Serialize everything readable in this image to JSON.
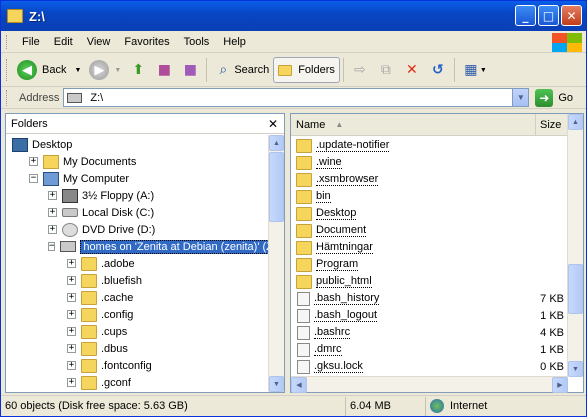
{
  "window": {
    "title": "Z:\\"
  },
  "menu": [
    {
      "label": "File",
      "accel": "F"
    },
    {
      "label": "Edit",
      "accel": "E"
    },
    {
      "label": "View",
      "accel": "V"
    },
    {
      "label": "Favorites",
      "accel": "a"
    },
    {
      "label": "Tools",
      "accel": "T"
    },
    {
      "label": "Help",
      "accel": "H"
    }
  ],
  "toolbar": {
    "back": "Back",
    "search": "Search",
    "folders": "Folders"
  },
  "address": {
    "label": "Address",
    "value": "Z:\\",
    "go": "Go"
  },
  "folders_pane": {
    "title": "Folders",
    "tree": [
      {
        "label": "Desktop",
        "icon": "desk",
        "expander": "",
        "indent": 0
      },
      {
        "label": "My Documents",
        "icon": "mydocs",
        "expander": "+",
        "indent": 1
      },
      {
        "label": "My Computer",
        "icon": "mycomp",
        "expander": "−",
        "indent": 1
      },
      {
        "label": "3½ Floppy (A:)",
        "icon": "floppy",
        "expander": "+",
        "indent": 2
      },
      {
        "label": "Local Disk (C:)",
        "icon": "drive",
        "expander": "+",
        "indent": 2
      },
      {
        "label": "DVD Drive (D:)",
        "icon": "cd",
        "expander": "+",
        "indent": 2
      },
      {
        "label": "homes on 'Zenita at Debian (zenita)' (Z:)",
        "icon": "net",
        "expander": "−",
        "indent": 2,
        "selected": true
      },
      {
        "label": ".adobe",
        "icon": "folder",
        "expander": "+",
        "indent": 3
      },
      {
        "label": ".bluefish",
        "icon": "folder",
        "expander": "+",
        "indent": 3
      },
      {
        "label": ".cache",
        "icon": "folder",
        "expander": "+",
        "indent": 3
      },
      {
        "label": ".config",
        "icon": "folder",
        "expander": "+",
        "indent": 3
      },
      {
        "label": ".cups",
        "icon": "folder",
        "expander": "+",
        "indent": 3
      },
      {
        "label": ".dbus",
        "icon": "folder",
        "expander": "+",
        "indent": 3
      },
      {
        "label": ".fontconfig",
        "icon": "folder",
        "expander": "+",
        "indent": 3
      },
      {
        "label": ".gconf",
        "icon": "folder",
        "expander": "+",
        "indent": 3
      }
    ]
  },
  "file_list": {
    "columns": {
      "name": "Name",
      "size": "Size"
    },
    "items": [
      {
        "name": ".update-notifier",
        "type": "folder",
        "size": ""
      },
      {
        "name": ".wine",
        "type": "folder",
        "size": ""
      },
      {
        "name": ".xsmbrowser",
        "type": "folder",
        "size": ""
      },
      {
        "name": "bin",
        "type": "folder",
        "size": ""
      },
      {
        "name": "Desktop",
        "type": "folder",
        "size": ""
      },
      {
        "name": "Document",
        "type": "folder",
        "size": ""
      },
      {
        "name": "Hämtningar",
        "type": "folder",
        "size": ""
      },
      {
        "name": "Program",
        "type": "folder",
        "size": ""
      },
      {
        "name": "public_html",
        "type": "folder",
        "size": ""
      },
      {
        "name": ".bash_history",
        "type": "file",
        "size": "7 KB"
      },
      {
        "name": ".bash_logout",
        "type": "file",
        "size": "1 KB"
      },
      {
        "name": ".bashrc",
        "type": "file",
        "size": "4 KB"
      },
      {
        "name": ".dmrc",
        "type": "file",
        "size": "1 KB"
      },
      {
        "name": ".gksu.lock",
        "type": "file",
        "size": "0 KB"
      }
    ]
  },
  "status": {
    "objects": "60 objects (Disk free space: 5.63 GB)",
    "size": "6.04 MB",
    "zone": "Internet"
  }
}
